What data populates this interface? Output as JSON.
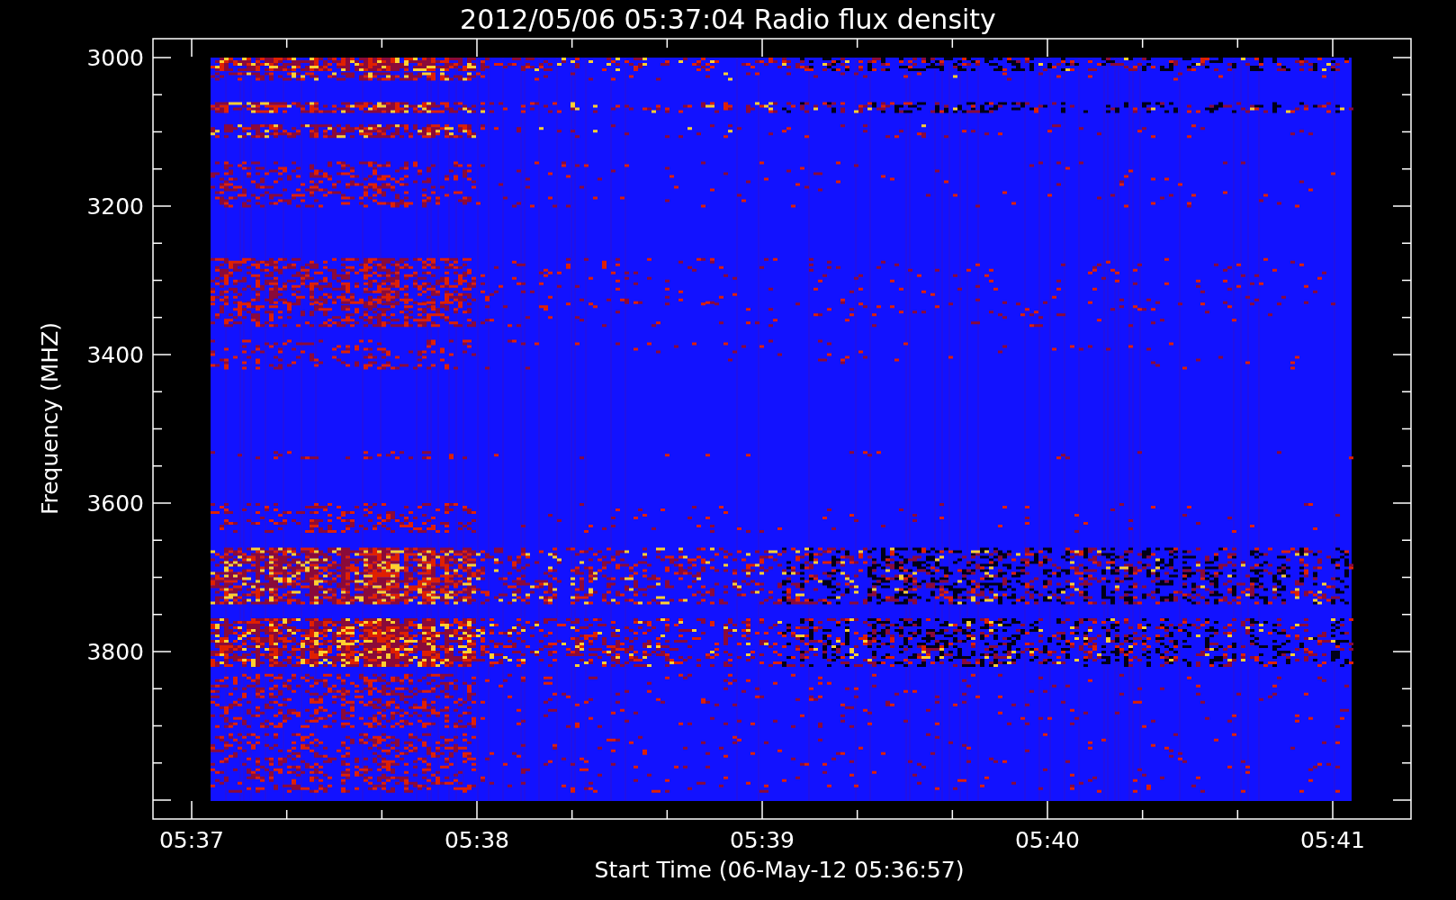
{
  "title": "2012/05/06 05:37:04 Radio flux density",
  "y_axis": {
    "label": "Frequency (MHZ)",
    "ticks": [
      "3000",
      "3200",
      "3400",
      "3600",
      "3800"
    ]
  },
  "x_axis": {
    "label": "Start Time (06-May-12 05:36:57)",
    "ticks": [
      "05:37",
      "05:38",
      "05:39",
      "05:40",
      "05:41"
    ]
  }
}
